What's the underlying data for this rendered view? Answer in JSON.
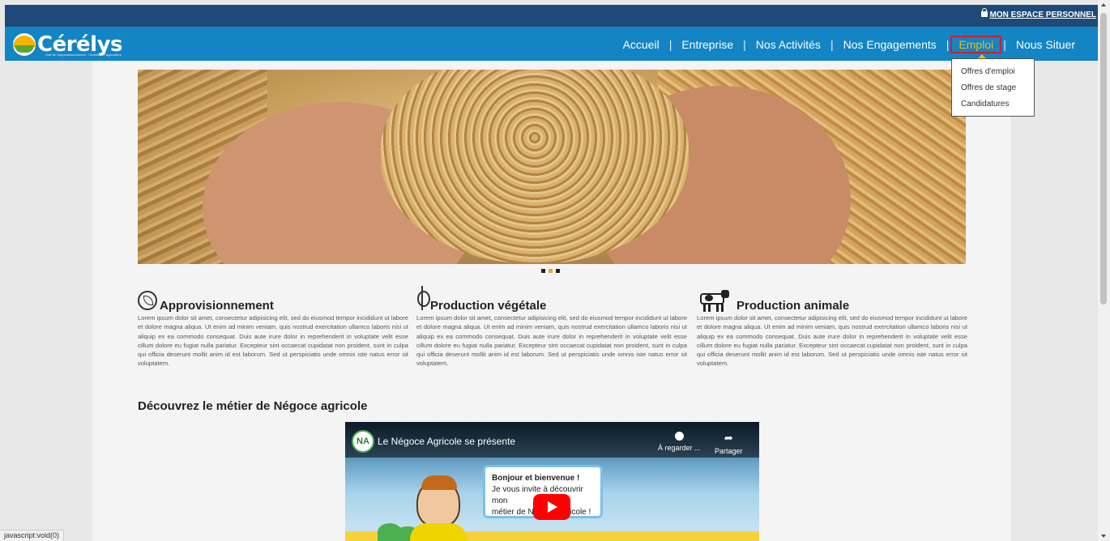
{
  "header": {
    "account_label": "MON ESPACE PERSONNEL",
    "brand": "Cérélys",
    "brand_tagline": "Unir de l'Approvisionnement · l'Avenir de l'Agriculture"
  },
  "nav": {
    "items": [
      {
        "label": "Accueil"
      },
      {
        "label": "Entreprise"
      },
      {
        "label": "Nos Activités"
      },
      {
        "label": "Nos Engagements"
      },
      {
        "label": "Emploi"
      },
      {
        "label": "Nous Situer"
      }
    ],
    "separator": "|",
    "active": "Emploi"
  },
  "dropdown": {
    "items": [
      "Offres d'emploi",
      "Offres de stage",
      "Candidatures"
    ]
  },
  "carousel": {
    "slide_index": 1,
    "slide_count": 3
  },
  "columns": [
    {
      "title": "Approvisionnement",
      "icon": "leaf-icon",
      "body": "Lorem ipsum dolor sit amet, consectetur adipisicing elit, sed do eiusmod tempor incididunt ut labore et dolore magna aliqua. Ut enim ad minim veniam, quis nostrud exercitation ullamco laboris nisi ut aliquip ex ea commodo consequat. Duis aute irure dolor in reprehenderit in voluptate velit esse cillum dolore eu fugiat nulla pariatur. Excepteur sint occaecat cupidatat non proident, sunt in culpa qui officia deserunt mollit anim id est laborum. Sed ut perspiciatis unde omnis iste natus error sit voluptatem."
    },
    {
      "title": "Production végétale",
      "icon": "wheat-icon",
      "body": "Lorem ipsum dolor sit amet, consectetur adipisicing elit, sed do eiusmod tempor incididunt ut labore et dolore magna aliqua. Ut enim ad minim veniam, quis nostrud exercitation ullamco laboris nisi ut aliquip ex ea commodo consequat. Duis aute irure dolor in reprehenderit in voluptate velit esse cillum dolore eu fugiat nulla pariatur. Excepteur sint occaecat cupidatat non proident, sunt in culpa qui officia deserunt mollit anim id est laborum. Sed ut perspiciatis unde omnis iste natus error sit voluptatem."
    },
    {
      "title": "Production animale",
      "icon": "cow-icon",
      "body": "Lorem ipsum dolor sit amet, consectetur adipisicing elit, sed do eiusmod tempor incididunt ut labore et dolore magna aliqua. Ut enim ad minim veniam, quis nostrud exercitation ullamco laboris nisi ut aliquip ex ea commodo consequat. Duis aute irure dolor in reprehenderit in voluptate velit esse cillum dolore eu fugiat nulla pariatur. Excepteur sint occaecat cupidatat non proident, sunt in culpa qui officia deserunt mollit anim id est laborum. Sed ut perspiciatis unde omnis iste natus error sit voluptatem."
    }
  ],
  "section": {
    "heading": "Découvrez le métier de Négoce agricole"
  },
  "video": {
    "title": "Le Négoce Agricole se présente",
    "channel_badge": "NA",
    "watch_later": "À regarder ...",
    "share": "Partager",
    "bubble_line1": "Bonjour et bienvenue !",
    "bubble_line2": "Je vous invite à découvrir mon",
    "bubble_line3": "métier de Négoce agricole !"
  },
  "status": {
    "link_preview": "javascript:void(0)"
  },
  "colors": {
    "top_bar": "#1d4a78",
    "nav_bar": "#1384c4",
    "accent": "#f5b90d",
    "highlight_outline": "#d0202b"
  }
}
